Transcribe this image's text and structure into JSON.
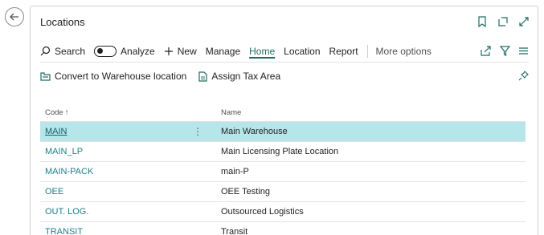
{
  "page": {
    "title": "Locations"
  },
  "actions": {
    "search": "Search",
    "analyze": "Analyze",
    "new": "New",
    "manage": "Manage",
    "home": "Home",
    "location": "Location",
    "report": "Report",
    "more": "More options"
  },
  "actions2": {
    "convert": "Convert to Warehouse location",
    "assign": "Assign Tax Area"
  },
  "grid": {
    "col_code": "Code",
    "sort_arrow": "↑",
    "col_name": "Name",
    "rows": [
      {
        "code": "MAIN",
        "name": "Main Warehouse"
      },
      {
        "code": "MAIN_LP",
        "name": "Main Licensing Plate Location"
      },
      {
        "code": "MAIN-PACK",
        "name": "main-P"
      },
      {
        "code": "OEE",
        "name": "OEE Testing"
      },
      {
        "code": "OUT. LOG.",
        "name": "Outsourced Logistics"
      },
      {
        "code": "TRANSIT",
        "name": "Transit"
      }
    ]
  },
  "colors": {
    "accent": "#1c7f8c",
    "selected_row": "#b7e6ea",
    "active_tab": "#1f6b62"
  },
  "icons": [
    "back-arrow-icon",
    "bookmark-icon",
    "open-in-new-icon",
    "expand-icon",
    "search-icon",
    "plus-icon",
    "share-icon",
    "filter-icon",
    "list-icon",
    "warehouse-icon",
    "document-icon",
    "pin-icon",
    "kebab-icon"
  ]
}
